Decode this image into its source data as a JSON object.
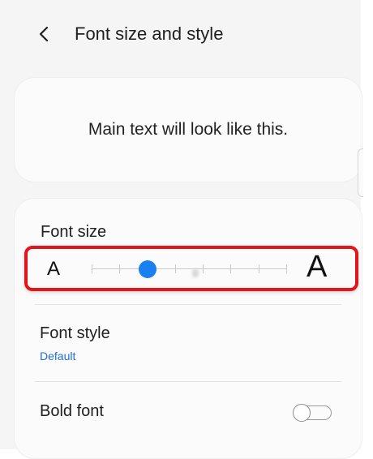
{
  "header": {
    "back_icon": "chevron-left-icon",
    "title": "Font size and style"
  },
  "preview": {
    "text": "Main text will look like this."
  },
  "font_size": {
    "label": "Font size",
    "small_label": "A",
    "large_label": "A",
    "slider": {
      "steps": 8,
      "selected_step": 2,
      "accent_color": "#1a7ff0"
    },
    "highlight_color": "#e4141b"
  },
  "font_style": {
    "label": "Font style",
    "value": "Default",
    "value_color": "#1f6fd1"
  },
  "bold_font": {
    "label": "Bold font",
    "toggle_on": false
  }
}
